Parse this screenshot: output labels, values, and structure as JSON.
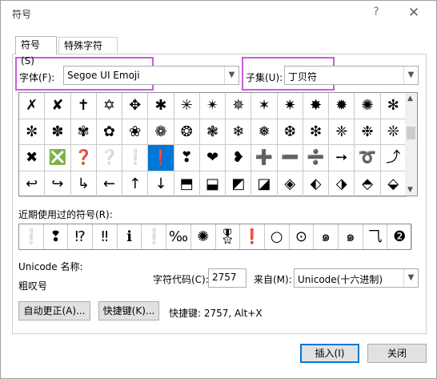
{
  "window": {
    "title": "符号",
    "help": "?",
    "close": "✕"
  },
  "tabs": [
    {
      "label": "符号(S)"
    },
    {
      "label": "特殊字符(P)"
    }
  ],
  "font": {
    "label": "字体(F):",
    "value": "Segoe UI Emoji"
  },
  "subset": {
    "label": "子集(U):",
    "value": "丁贝符"
  },
  "symbols": [
    [
      "✗",
      "✘",
      "✝",
      "✡",
      "✥",
      "✱",
      "✳",
      "✴",
      "✵",
      "✶",
      "✷",
      "✸",
      "✹",
      "✺",
      "✻"
    ],
    [
      "✼",
      "✽",
      "✾",
      "✿",
      "❀",
      "❁",
      "❂",
      "❃",
      "❄",
      "❅",
      "❆",
      "❇",
      "❈",
      "❉",
      "❊"
    ],
    [
      "✖",
      "❎",
      "❓",
      "❔",
      "❕",
      "❗",
      "❣",
      "❤",
      "❥",
      "➕",
      "➖",
      "➗",
      "➙",
      "➰",
      "⤴"
    ],
    [
      "↩",
      "↪",
      "↳",
      "←",
      "↑",
      "↓",
      "⬒",
      "⬓",
      "◩",
      "◪",
      "◈",
      "⬖",
      "⬗",
      "⬘",
      "⬙"
    ]
  ],
  "recent_label": "近期使用过的符号(R):",
  "recent": [
    "❕",
    "❢",
    "⁉",
    "‼",
    "ℹ",
    "❕",
    "‰",
    "✺",
    "🎖",
    "❗",
    "○",
    "⊙",
    "๑",
    "๑",
    "⺄",
    "❷"
  ],
  "unicode_name_label": "Unicode 名称:",
  "unicode_name_value": "粗叹号",
  "char_code": {
    "label": "字符代码(C):",
    "value": "2757"
  },
  "from": {
    "label": "来自(M):",
    "value": "Unicode(十六进制)"
  },
  "buttons": {
    "autocorrect": "自动更正(A)...",
    "shortcut_key": "快捷键(K)...",
    "insert": "插入(I)",
    "close": "关闭"
  },
  "shortcut_info": "快捷键: 2757, Alt+X",
  "colors": {
    "highlight": "#c75fd8",
    "selected": "#0078d7"
  }
}
